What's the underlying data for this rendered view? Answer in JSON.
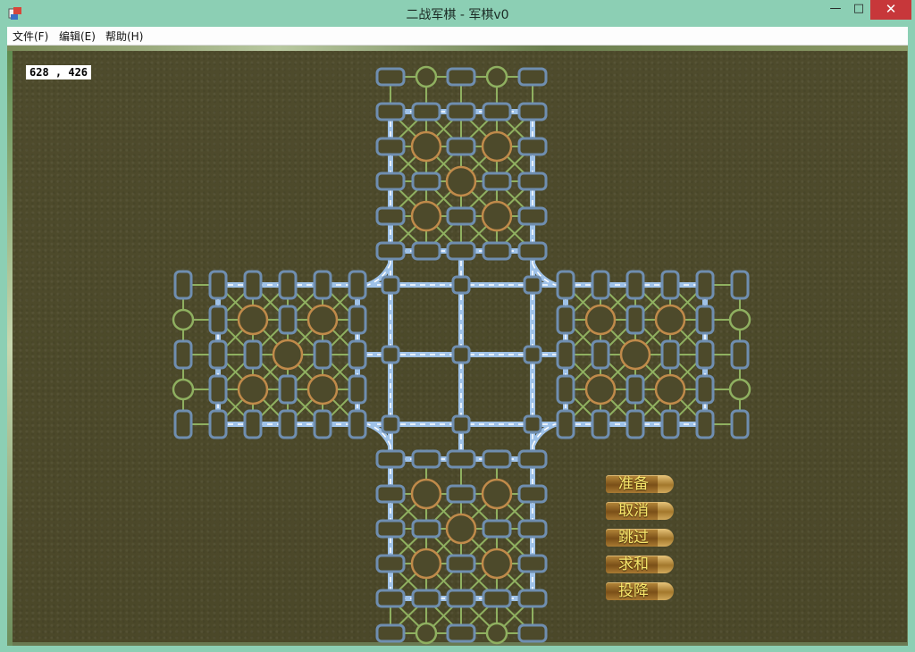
{
  "window": {
    "title": "二战军棋 - 军棋v0",
    "minimize_glyph": "—",
    "maximize_glyph": "□",
    "close_glyph": "✕",
    "app_icon": "app-icon"
  },
  "menu": {
    "items": [
      {
        "label": "文件(F)"
      },
      {
        "label": "编辑(E)"
      },
      {
        "label": "帮助(H)"
      }
    ]
  },
  "status": {
    "cursor_coords": "628 , 426"
  },
  "actions": [
    {
      "label": "准备"
    },
    {
      "label": "取消"
    },
    {
      "label": "跳过"
    },
    {
      "label": "求和"
    },
    {
      "label": "投降"
    }
  ],
  "colors": {
    "rail": "#9fc2e8",
    "rail_dash": "#ffffff",
    "post_border": "#6f8eb0",
    "station_border": "#c08a4a",
    "headquarters_border": "#8fb060",
    "road": "#8fb060",
    "board_bg": "#4d4a2b"
  }
}
